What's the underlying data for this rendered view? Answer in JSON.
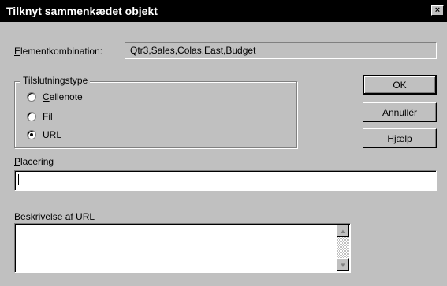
{
  "window": {
    "title": "Tilknyt sammenkædet objekt",
    "close_glyph": "×"
  },
  "element_combination": {
    "label_key": "E",
    "label_rest": "lementkombination:",
    "value": "Qtr3,Sales,Colas,East,Budget"
  },
  "connection_type": {
    "title": "Tilslutningstype",
    "options": [
      {
        "key": "C",
        "rest": "ellenote",
        "checked": false
      },
      {
        "key": "F",
        "rest": "il",
        "checked": false
      },
      {
        "key": "U",
        "rest": "RL",
        "checked": true
      }
    ]
  },
  "buttons": {
    "ok": "OK",
    "cancel": "Annullér",
    "help_key": "H",
    "help_rest": "jælp"
  },
  "placement": {
    "label_key": "P",
    "label_rest": "lacering",
    "value": ""
  },
  "description": {
    "label_pre": "Be",
    "label_key": "s",
    "label_rest": "krivelse af URL",
    "value": ""
  },
  "icons": {
    "scroll_up": "▲",
    "scroll_down": "▼"
  }
}
